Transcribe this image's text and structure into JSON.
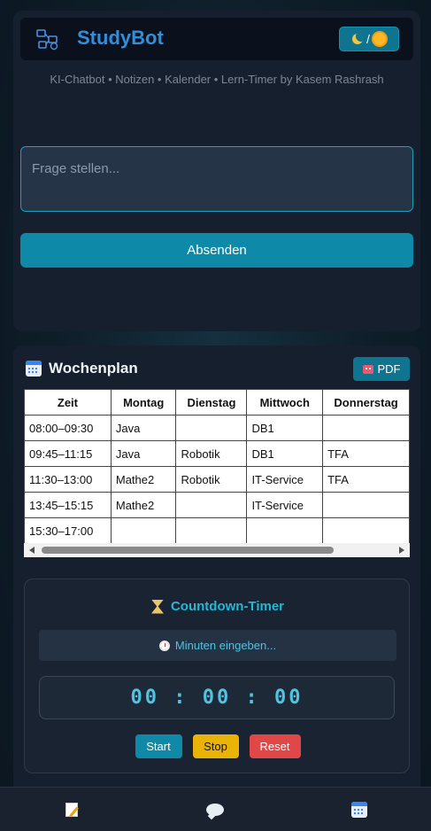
{
  "app": {
    "title": "StudyBot",
    "theme_toggle_separator": "/",
    "subtitle": "KI-Chatbot • Notizen • Kalender • Lern-Timer by Kasem Rashrash"
  },
  "chat": {
    "input_placeholder": "Frage stellen...",
    "input_value": "",
    "send_label": "Absenden"
  },
  "schedule": {
    "title": "Wochenplan",
    "pdf_label": "PDF",
    "columns": [
      "Zeit",
      "Montag",
      "Dienstag",
      "Mittwoch",
      "Donnerstag"
    ],
    "rows": [
      [
        "08:00–09:30",
        "Java",
        "",
        "DB1",
        ""
      ],
      [
        "09:45–11:15",
        "Java",
        "Robotik",
        "DB1",
        "TFA"
      ],
      [
        "11:30–13:00",
        "Mathe2",
        "Robotik",
        "IT-Service",
        "TFA"
      ],
      [
        "13:45–15:15",
        "Mathe2",
        "",
        "IT-Service",
        ""
      ],
      [
        "15:30–17:00",
        "",
        "",
        "",
        ""
      ]
    ]
  },
  "timer": {
    "title": "Countdown-Timer",
    "minutes_placeholder": "Minuten eingeben...",
    "display": "00 : 00 : 00",
    "start_label": "Start",
    "stop_label": "Stop",
    "reset_label": "Reset"
  },
  "icons": {
    "logo": "robot-network-icon",
    "theme_moon": "moon-icon",
    "theme_sun": "sun-icon",
    "schedule": "calendar-icon",
    "pdf": "robot-icon",
    "timer": "hourglass-icon",
    "minutes": "alarm-clock-icon",
    "nav_notes": "memo-icon",
    "nav_chat": "speech-bubble-icon",
    "nav_calendar": "calendar-icon"
  },
  "colors": {
    "accent": "#0e8aa8",
    "title_blue": "#2f8fdd",
    "timer_cyan": "#22b8d6",
    "stop_yellow": "#eab308",
    "reset_red": "#e04848"
  }
}
